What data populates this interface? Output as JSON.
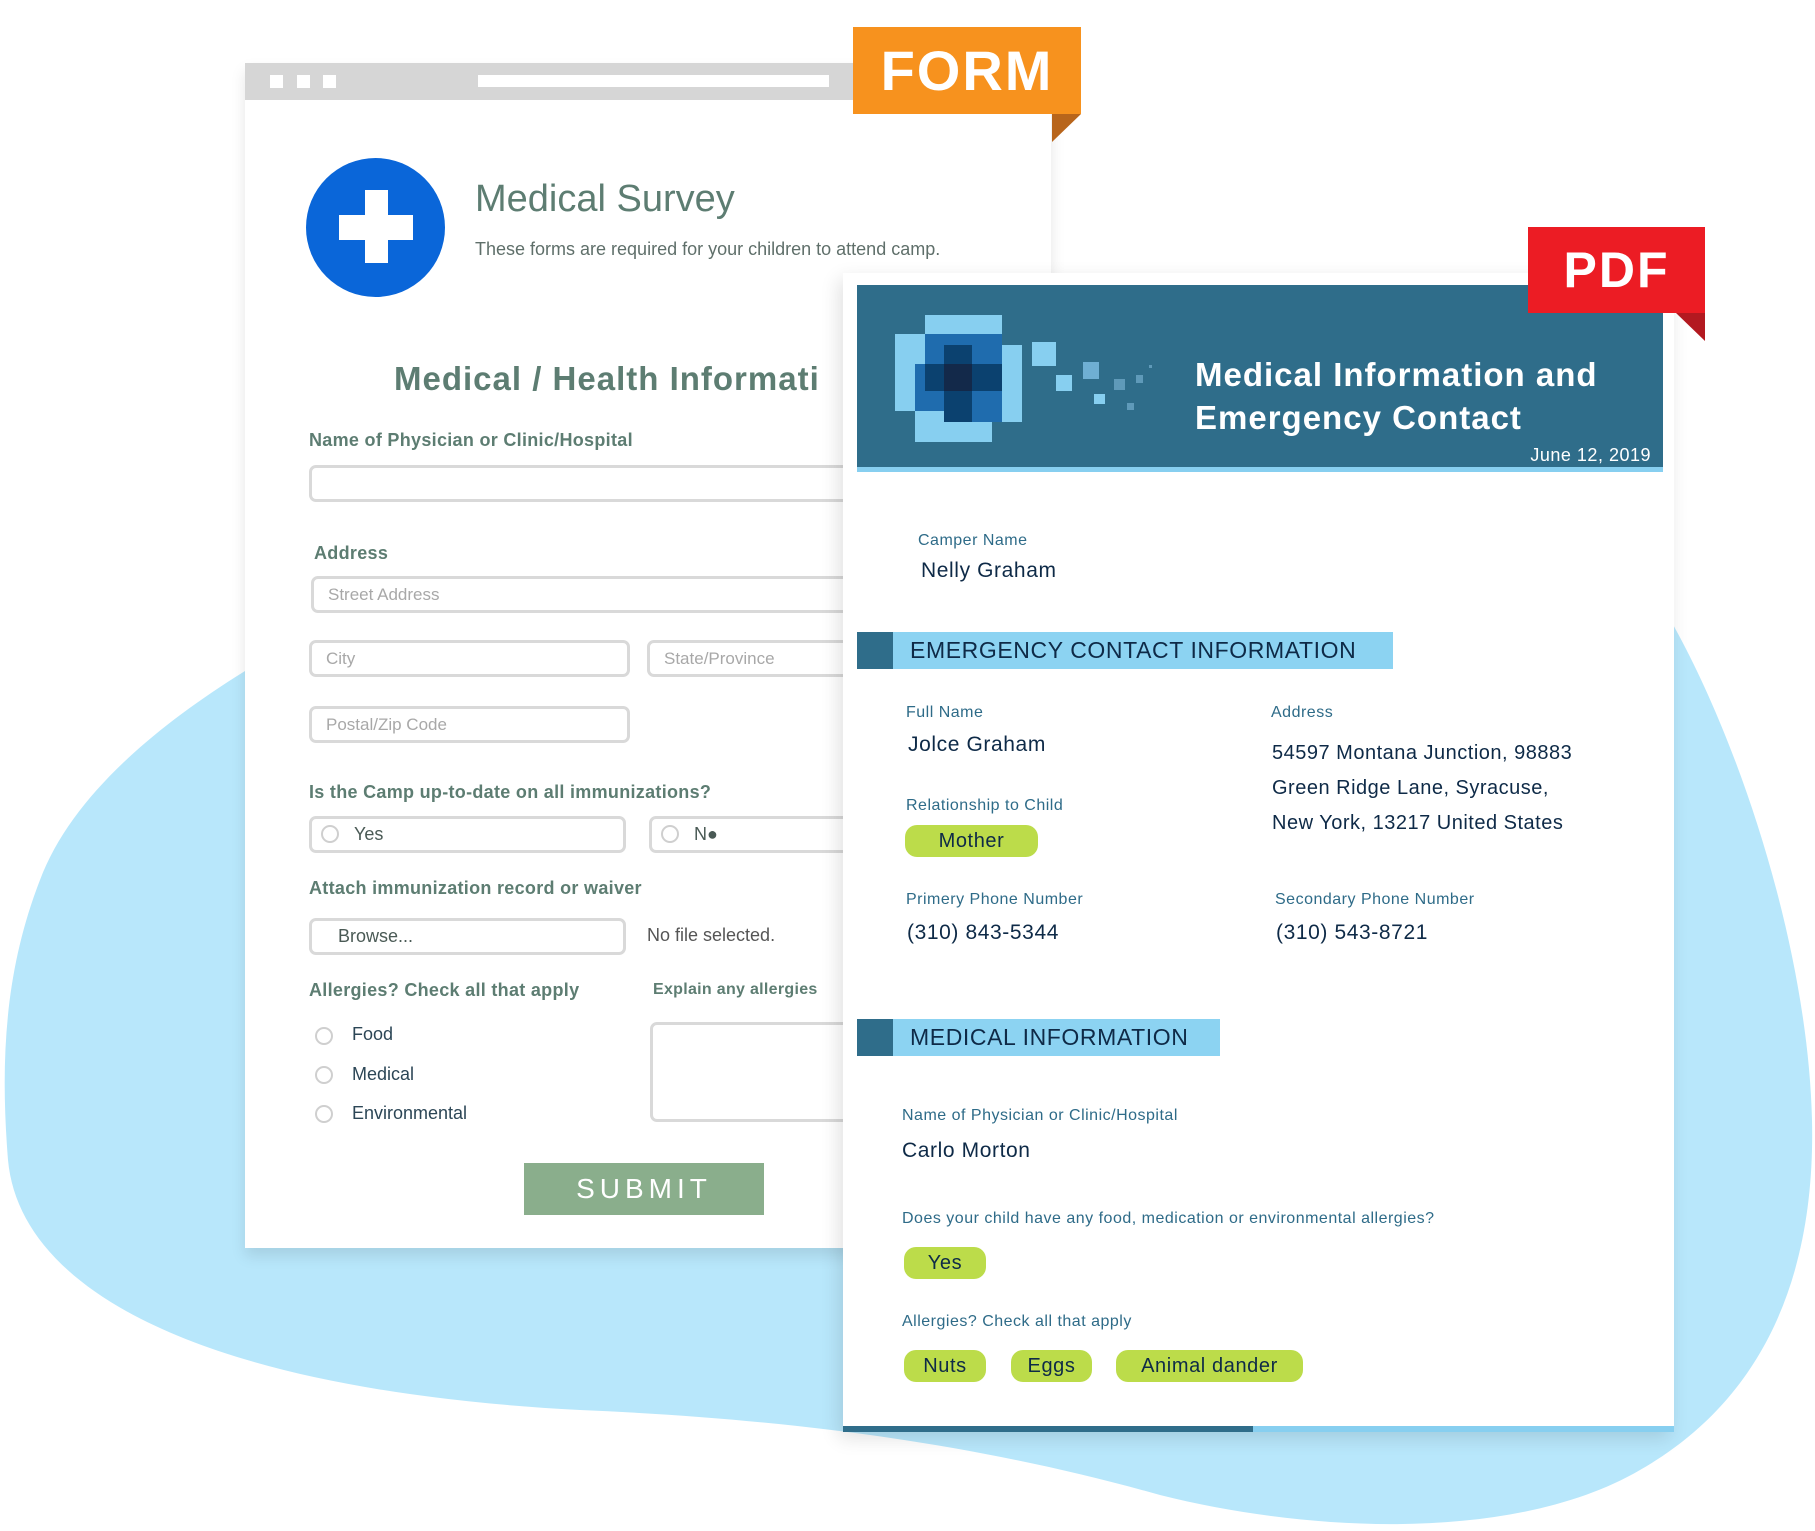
{
  "colors": {
    "blob": "#B8E7FB",
    "form_accent": "#5D7D72",
    "submit": "#8AAE8C",
    "form_tag": "#F7921E",
    "pdf_tag": "#EC1C24",
    "pdf_header": "#2F6D8A",
    "pdf_light": "#8CD3F2",
    "pill": "#BCDC4A",
    "medical_icon": "#0A66D9"
  },
  "tags": {
    "form": "FORM",
    "pdf": "PDF"
  },
  "form": {
    "browser_icons": [
      "window-dot",
      "window-dot",
      "window-dot"
    ],
    "logo_icon": "medical-cross-icon",
    "title": "Medical Survey",
    "subtitle": "These forms are required for your children to attend camp.",
    "section_title": "Medical / Health Informati",
    "physician_label": "Name of Physician or Clinic/Hospital",
    "physician_value": "",
    "address_label": "Address",
    "street_placeholder": "Street Address",
    "city_placeholder": "City",
    "state_placeholder": "State/Province",
    "zip_placeholder": "Postal/Zip Code",
    "immunization_question": "Is the Camp up-to-date on all immunizations?",
    "immunization_options": [
      "Yes",
      "N●"
    ],
    "attach_label": "Attach immunization record or waiver",
    "browse_label": "Browse...",
    "file_status": "No file selected.",
    "allergies_label": "Allergies? Check all that apply",
    "allergy_options": [
      "Food",
      "Medical",
      "Environmental"
    ],
    "explain_label": "Explain any allergies",
    "explain_value": "",
    "submit_label": "SUBMIT"
  },
  "pdf": {
    "title_line1": "Medical Information and",
    "title_line2": "Emergency Contact",
    "date": "June 12, 2019",
    "camper_name_label": "Camper Name",
    "camper_name": "Nelly Graham",
    "emergency_section": "EMERGENCY CONTACT INFORMATION",
    "full_name_label": "Full Name",
    "full_name": "Jolce Graham",
    "address_label": "Address",
    "address_lines": [
      "54597 Montana Junction, 98883",
      "Green Ridge Lane, Syracuse,",
      "New York, 13217 United States"
    ],
    "relationship_label": "Relationship to Child",
    "relationship": "Mother",
    "primary_phone_label": "Primery Phone Number",
    "primary_phone": "(310) 843-5344",
    "secondary_phone_label": "Secondary Phone Number",
    "secondary_phone": "(310) 543-8721",
    "medical_section": "MEDICAL INFORMATION",
    "physician_label": "Name of Physician or Clinic/Hospital",
    "physician": "Carlo Morton",
    "allergy_question": "Does your child have any food, medication or environmental allergies?",
    "allergy_answer": "Yes",
    "allergies_label": "Allergies? Check all that apply",
    "allergies": [
      "Nuts",
      "Eggs",
      "Animal dander"
    ]
  }
}
